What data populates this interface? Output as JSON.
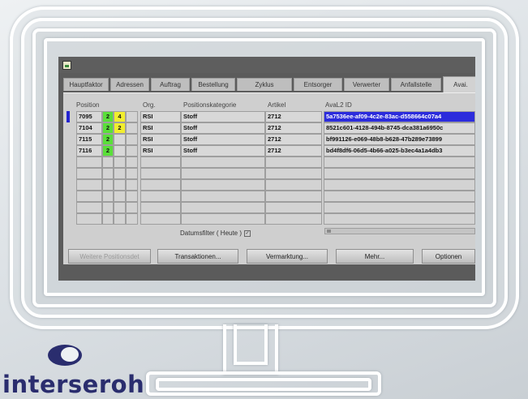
{
  "tabs": [
    "Hauptfaktor",
    "Adressen",
    "Auftrag",
    "Bestellung",
    "Zyklus",
    "Entsorger",
    "Verwerter",
    "Anfallstelle",
    "Avai."
  ],
  "active_tab_index": 8,
  "headers": {
    "position": "Position",
    "org": "Org.",
    "kategorie": "Positionskategorie",
    "artikel": "Artikel",
    "avail_id": "AvaL2 ID"
  },
  "rows": [
    {
      "pos": "7095",
      "s1": "2",
      "s2": "4",
      "org": "RSI",
      "kat": "Stoff",
      "art": "2712",
      "id": "5a7536ee-af09-4c2e-83ac-d558664c07a4"
    },
    {
      "pos": "7104",
      "s1": "2",
      "s2": "2",
      "org": "RSI",
      "kat": "Stoff",
      "art": "2712",
      "id": "8521c601-4128-494b-8745-dca381a6950c"
    },
    {
      "pos": "7115",
      "s1": "2",
      "s2": "",
      "org": "RSI",
      "kat": "Stoff",
      "art": "2712",
      "id": "bf991126-e069-48b8-b628-47b289e73899"
    },
    {
      "pos": "7116",
      "s1": "2",
      "s2": "",
      "org": "RSI",
      "kat": "Stoff",
      "art": "2712",
      "id": "bd4f8df6-06d5-4b66-a025-b3ec4a1a4db3"
    }
  ],
  "colors": {
    "status_green": "#5adf3a",
    "status_yellow": "#f2ee2e",
    "selection": "#2c2cdc"
  },
  "datumsfilter": "Datumsfilter  ( Heute )",
  "datumsfilter_checked": true,
  "buttons": {
    "weitere": "Weitere Positionsdet",
    "transaktionen": "Transaktionen...",
    "vermarktung": "Vermarktung...",
    "mehr": "Mehr...",
    "optionen": "Optionen"
  },
  "logo": {
    "text": "interseroh"
  }
}
